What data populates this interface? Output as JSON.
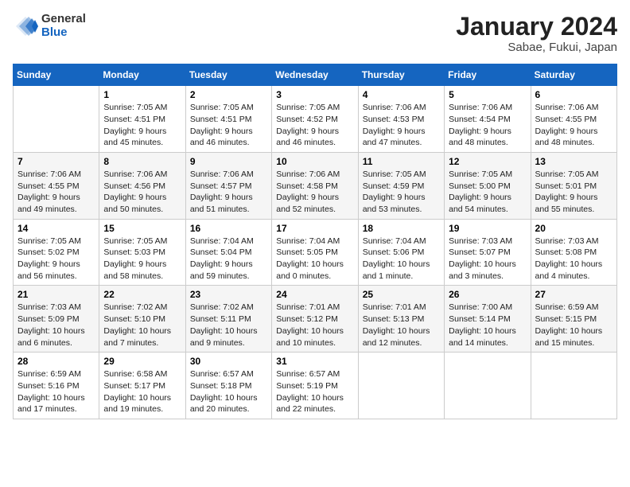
{
  "logo": {
    "general": "General",
    "blue": "Blue"
  },
  "title": "January 2024",
  "subtitle": "Sabae, Fukui, Japan",
  "days_of_week": [
    "Sunday",
    "Monday",
    "Tuesday",
    "Wednesday",
    "Thursday",
    "Friday",
    "Saturday"
  ],
  "weeks": [
    [
      {
        "day": "",
        "info": ""
      },
      {
        "day": "1",
        "info": "Sunrise: 7:05 AM\nSunset: 4:51 PM\nDaylight: 9 hours\nand 45 minutes."
      },
      {
        "day": "2",
        "info": "Sunrise: 7:05 AM\nSunset: 4:51 PM\nDaylight: 9 hours\nand 46 minutes."
      },
      {
        "day": "3",
        "info": "Sunrise: 7:05 AM\nSunset: 4:52 PM\nDaylight: 9 hours\nand 46 minutes."
      },
      {
        "day": "4",
        "info": "Sunrise: 7:06 AM\nSunset: 4:53 PM\nDaylight: 9 hours\nand 47 minutes."
      },
      {
        "day": "5",
        "info": "Sunrise: 7:06 AM\nSunset: 4:54 PM\nDaylight: 9 hours\nand 48 minutes."
      },
      {
        "day": "6",
        "info": "Sunrise: 7:06 AM\nSunset: 4:55 PM\nDaylight: 9 hours\nand 48 minutes."
      }
    ],
    [
      {
        "day": "7",
        "info": "Sunrise: 7:06 AM\nSunset: 4:55 PM\nDaylight: 9 hours\nand 49 minutes."
      },
      {
        "day": "8",
        "info": "Sunrise: 7:06 AM\nSunset: 4:56 PM\nDaylight: 9 hours\nand 50 minutes."
      },
      {
        "day": "9",
        "info": "Sunrise: 7:06 AM\nSunset: 4:57 PM\nDaylight: 9 hours\nand 51 minutes."
      },
      {
        "day": "10",
        "info": "Sunrise: 7:06 AM\nSunset: 4:58 PM\nDaylight: 9 hours\nand 52 minutes."
      },
      {
        "day": "11",
        "info": "Sunrise: 7:05 AM\nSunset: 4:59 PM\nDaylight: 9 hours\nand 53 minutes."
      },
      {
        "day": "12",
        "info": "Sunrise: 7:05 AM\nSunset: 5:00 PM\nDaylight: 9 hours\nand 54 minutes."
      },
      {
        "day": "13",
        "info": "Sunrise: 7:05 AM\nSunset: 5:01 PM\nDaylight: 9 hours\nand 55 minutes."
      }
    ],
    [
      {
        "day": "14",
        "info": "Sunrise: 7:05 AM\nSunset: 5:02 PM\nDaylight: 9 hours\nand 56 minutes."
      },
      {
        "day": "15",
        "info": "Sunrise: 7:05 AM\nSunset: 5:03 PM\nDaylight: 9 hours\nand 58 minutes."
      },
      {
        "day": "16",
        "info": "Sunrise: 7:04 AM\nSunset: 5:04 PM\nDaylight: 9 hours\nand 59 minutes."
      },
      {
        "day": "17",
        "info": "Sunrise: 7:04 AM\nSunset: 5:05 PM\nDaylight: 10 hours\nand 0 minutes."
      },
      {
        "day": "18",
        "info": "Sunrise: 7:04 AM\nSunset: 5:06 PM\nDaylight: 10 hours\nand 1 minute."
      },
      {
        "day": "19",
        "info": "Sunrise: 7:03 AM\nSunset: 5:07 PM\nDaylight: 10 hours\nand 3 minutes."
      },
      {
        "day": "20",
        "info": "Sunrise: 7:03 AM\nSunset: 5:08 PM\nDaylight: 10 hours\nand 4 minutes."
      }
    ],
    [
      {
        "day": "21",
        "info": "Sunrise: 7:03 AM\nSunset: 5:09 PM\nDaylight: 10 hours\nand 6 minutes."
      },
      {
        "day": "22",
        "info": "Sunrise: 7:02 AM\nSunset: 5:10 PM\nDaylight: 10 hours\nand 7 minutes."
      },
      {
        "day": "23",
        "info": "Sunrise: 7:02 AM\nSunset: 5:11 PM\nDaylight: 10 hours\nand 9 minutes."
      },
      {
        "day": "24",
        "info": "Sunrise: 7:01 AM\nSunset: 5:12 PM\nDaylight: 10 hours\nand 10 minutes."
      },
      {
        "day": "25",
        "info": "Sunrise: 7:01 AM\nSunset: 5:13 PM\nDaylight: 10 hours\nand 12 minutes."
      },
      {
        "day": "26",
        "info": "Sunrise: 7:00 AM\nSunset: 5:14 PM\nDaylight: 10 hours\nand 14 minutes."
      },
      {
        "day": "27",
        "info": "Sunrise: 6:59 AM\nSunset: 5:15 PM\nDaylight: 10 hours\nand 15 minutes."
      }
    ],
    [
      {
        "day": "28",
        "info": "Sunrise: 6:59 AM\nSunset: 5:16 PM\nDaylight: 10 hours\nand 17 minutes."
      },
      {
        "day": "29",
        "info": "Sunrise: 6:58 AM\nSunset: 5:17 PM\nDaylight: 10 hours\nand 19 minutes."
      },
      {
        "day": "30",
        "info": "Sunrise: 6:57 AM\nSunset: 5:18 PM\nDaylight: 10 hours\nand 20 minutes."
      },
      {
        "day": "31",
        "info": "Sunrise: 6:57 AM\nSunset: 5:19 PM\nDaylight: 10 hours\nand 22 minutes."
      },
      {
        "day": "",
        "info": ""
      },
      {
        "day": "",
        "info": ""
      },
      {
        "day": "",
        "info": ""
      }
    ]
  ]
}
